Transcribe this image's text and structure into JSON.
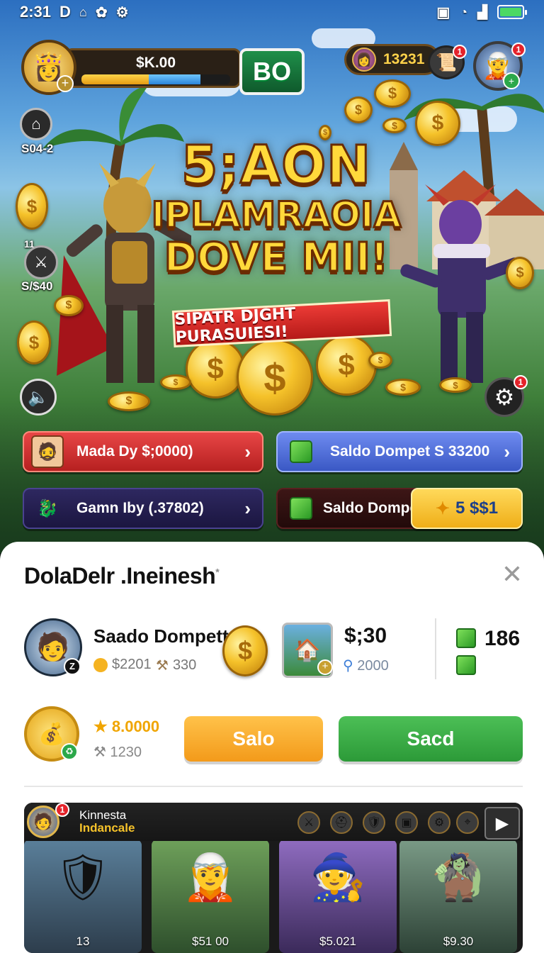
{
  "status_bar": {
    "time": "2:31",
    "left_icons": [
      "d-icon",
      "notification-icon",
      "settings-icon",
      "gear-icon"
    ],
    "right_icons": [
      "vibrate-icon",
      "wifi-icon",
      "signal-icon",
      "battery-icon"
    ]
  },
  "player": {
    "money": "$K.00",
    "xp_gold_fraction": 0.45,
    "xp_blue_fraction": 0.35
  },
  "top_badge": "BO",
  "currency": {
    "value": "13231",
    "mail_notification": "1",
    "hero_notification": "1"
  },
  "side": {
    "home_label": "S04-2",
    "quest_level": "11",
    "quest_label": "S/$40"
  },
  "headline": {
    "line1": "5;AON",
    "line2": "IPLAMRAOIA",
    "line3": "DOVE MII!",
    "ribbon": "SIPATR DJGHT PURASUIESI!"
  },
  "settings_notification": "1",
  "buttons": [
    {
      "label": "Mada Dy $;0000)",
      "color": "#d63232"
    },
    {
      "label": "Saldo Dompet S 33200",
      "color": "#4f6ed6"
    },
    {
      "label": "Gamn Iby (.37802)",
      "color": "#2a2450"
    },
    {
      "label": "Saldo Dompet",
      "color": "#3a1414"
    },
    {
      "label": "5 $$1",
      "color": "#f6c23a"
    }
  ],
  "sheet": {
    "title": "DolaDelr .Ineinesh",
    "title_mark": "*",
    "profile": {
      "name": "Saado Dompett",
      "coins": "$2201",
      "other": "330",
      "z_badge": "Z"
    },
    "amount": {
      "value": "$;30",
      "sub": "2000"
    },
    "gems": {
      "count": "186"
    },
    "star_value": "8.0000",
    "small_value": "1230",
    "btn_primary": "Salo",
    "btn_secondary": "Sacd",
    "colors": {
      "orange": "#f7a928",
      "green": "#37a845"
    }
  },
  "gallery": {
    "title": "Kinnesta",
    "subtitle": "Indancale",
    "notification": "1",
    "cards": [
      {
        "caption": "13",
        "bg": "#3b5a72"
      },
      {
        "caption": "$51 00",
        "bg": "#3f6e3a"
      },
      {
        "caption": "$5.021",
        "bg": "#6c4a8e"
      },
      {
        "caption": "$9.30",
        "bg": "#4a6b55"
      }
    ]
  }
}
